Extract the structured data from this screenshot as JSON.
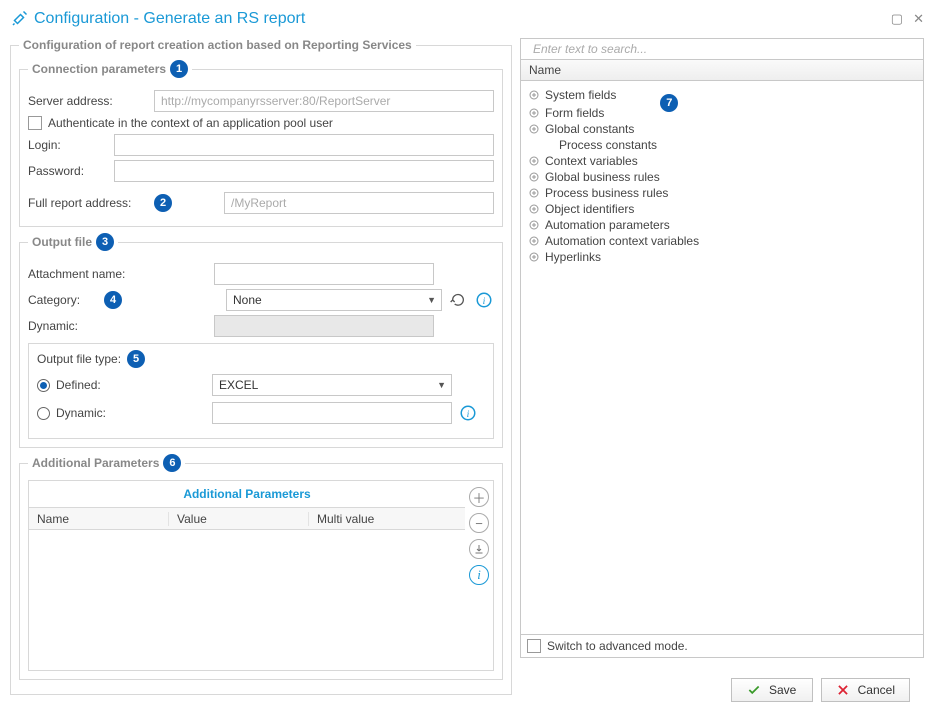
{
  "window": {
    "title": "Configuration - Generate an RS report",
    "maximize_tooltip": "Maximize",
    "close_tooltip": "Close"
  },
  "badges": {
    "b1": "1",
    "b2": "2",
    "b3": "3",
    "b4": "4",
    "b5": "5",
    "b6": "6",
    "b7": "7"
  },
  "fs_main": {
    "legend": "Configuration of report creation action based on Reporting Services"
  },
  "conn": {
    "legend": "Connection parameters",
    "server_label": "Server address:",
    "server_placeholder": "http://mycompanyrsserver:80/ReportServer",
    "auth_label": "Authenticate in the context of an application pool user",
    "login_label": "Login:",
    "password_label": "Password:",
    "full_addr_label": "Full report address:",
    "full_addr_placeholder": "/MyReport"
  },
  "output": {
    "legend": "Output file",
    "att_label": "Attachment name:",
    "cat_label": "Category:",
    "cat_value": "None",
    "dyn_label": "Dynamic:",
    "oft_label": "Output file type:",
    "defined_label": "Defined:",
    "defined_value": "EXCEL",
    "oft_dyn_label": "Dynamic:"
  },
  "params": {
    "legend": "Additional Parameters",
    "header": "Additional Parameters",
    "col_name": "Name",
    "col_value": "Value",
    "col_multi": "Multi value"
  },
  "sidebar": {
    "search_placeholder": "Enter text to search...",
    "col_header": "Name",
    "items": [
      "System fields",
      "Form fields",
      "Global constants",
      "Process constants",
      "Context variables",
      "Global business rules",
      "Process business rules",
      "Object identifiers",
      "Automation parameters",
      "Automation context variables",
      "Hyperlinks"
    ],
    "adv_label": "Switch to advanced mode."
  },
  "footer": {
    "save": "Save",
    "cancel": "Cancel"
  }
}
